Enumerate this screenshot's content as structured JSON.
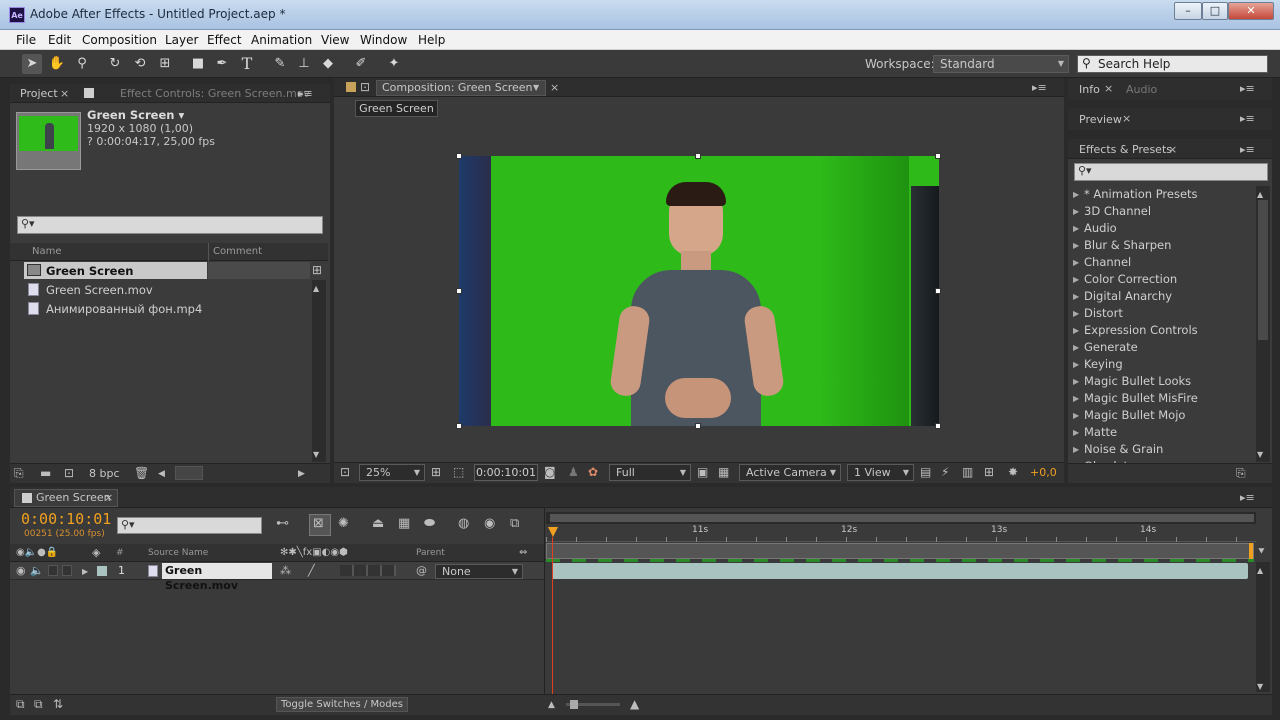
{
  "window": {
    "title": "Adobe After Effects - Untitled Project.aep *",
    "logo_text": "Ae",
    "minimize": "–",
    "maximize": "□",
    "close": "✕"
  },
  "menu": [
    "File",
    "Edit",
    "Composition",
    "Layer",
    "Effect",
    "Animation",
    "View",
    "Window",
    "Help"
  ],
  "toolbar": {
    "workspace_label": "Workspace:",
    "workspace_value": "Standard",
    "search_help": "Search Help"
  },
  "project": {
    "tab_label": "Project",
    "effect_controls_label": "Effect Controls: Green Screen.mov",
    "selected_name": "Green Screen ▾",
    "selected_dims": "1920 x 1080 (1,00)",
    "selected_duration": "? 0:00:04:17, 25,00 fps",
    "col_name": "Name",
    "col_comment": "Comment",
    "items": [
      "Green Screen",
      "Green Screen.mov",
      "Анимированный фон.mp4"
    ],
    "bpc": "8 bpc"
  },
  "composition": {
    "tab_label": "Composition: Green Screen",
    "sub_tab": "Green Screen",
    "zoom": "25%",
    "timecode": "0:00:10:01",
    "resolution": "Full",
    "camera": "Active Camera",
    "views": "1 View",
    "exposure": "+0,0"
  },
  "right_panels": {
    "info": "Info",
    "audio": "Audio",
    "preview": "Preview",
    "effects_presets": "Effects & Presets",
    "effects": [
      "* Animation Presets",
      "3D Channel",
      "Audio",
      "Blur & Sharpen",
      "Channel",
      "Color Correction",
      "Digital Anarchy",
      "Distort",
      "Expression Controls",
      "Generate",
      "Keying",
      "Magic Bullet Looks",
      "Magic Bullet MisFire",
      "Magic Bullet Mojo",
      "Matte",
      "Noise & Grain",
      "Obsolete"
    ]
  },
  "timeline": {
    "tab_label": "Green Screen",
    "timecode": "0:00:10:01",
    "frame_info": "00251 (25.00 fps)",
    "col_num": "#",
    "col_source": "Source Name",
    "col_parent": "Parent",
    "layer_num": "1",
    "layer_name": "Green Screen.mov",
    "layer_parent": "None",
    "ruler": [
      "11s",
      "12s",
      "13s",
      "14s"
    ],
    "toggle_label": "Toggle Switches / Modes"
  },
  "colors": {
    "accent_time": "#f0a020",
    "green": "#2dbd17",
    "layer_bar": "#a9c4c0"
  }
}
